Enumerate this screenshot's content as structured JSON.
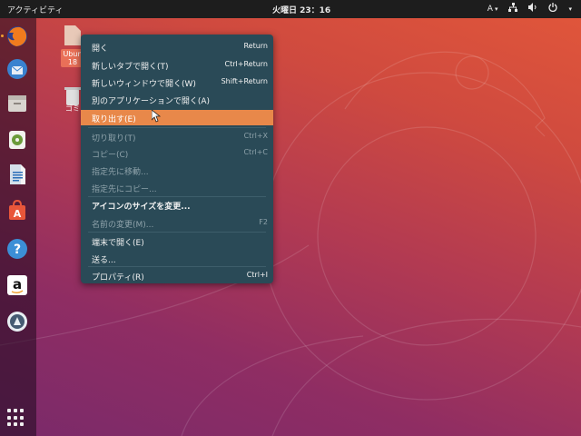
{
  "topbar": {
    "activities": "アクティビティ",
    "clock": "火曜日 23：16",
    "input_method": "A",
    "input_method_caret": "▾",
    "network_icon": "network-icon",
    "volume_icon": "volume-icon",
    "power_icon": "power-icon",
    "menu_caret": "▾"
  },
  "dock": {
    "items": [
      {
        "name": "Firefox",
        "icon": "firefox-icon",
        "color": "#e76b1a"
      },
      {
        "name": "Thunderbird",
        "icon": "thunderbird-icon",
        "color": "#2f6fb8"
      },
      {
        "name": "Files",
        "icon": "files-icon",
        "color": "#c9c6c1"
      },
      {
        "name": "Rhythmbox",
        "icon": "rhythmbox-icon",
        "color": "#e9e9e6"
      },
      {
        "name": "LibreOffice Writer",
        "icon": "writer-icon",
        "color": "#2a6fb8"
      },
      {
        "name": "Ubuntu Software",
        "icon": "software-icon",
        "color": "#e9563a"
      },
      {
        "name": "Help",
        "icon": "help-icon",
        "color": "#3c8fd6"
      },
      {
        "name": "Amazon",
        "icon": "amazon-icon",
        "color": "#ffffff"
      },
      {
        "name": "Disk Utility",
        "icon": "disk-icon",
        "color": "#455b73"
      }
    ],
    "show_apps_icon": "grid-icon"
  },
  "desktop": {
    "icon1_label_top": "Ubun",
    "icon1_label_bottom": "18",
    "icon2_label": "ゴミ"
  },
  "menu": {
    "items": [
      {
        "label": "開く",
        "shortcut": "Return",
        "state": "normal"
      },
      {
        "label": "新しいタブで開く(T)",
        "shortcut": "Ctrl+Return",
        "state": "normal"
      },
      {
        "label": "新しいウィンドウで開く(W)",
        "shortcut": "Shift+Return",
        "state": "normal"
      },
      {
        "label": "別のアプリケーションで開く(A)",
        "shortcut": "",
        "state": "normal"
      },
      {
        "label": "取り出す(E)",
        "shortcut": "",
        "state": "hover"
      },
      {
        "label": "切り取り(T)",
        "shortcut": "Ctrl+X",
        "state": "disabled"
      },
      {
        "label": "コピー(C)",
        "shortcut": "Ctrl+C",
        "state": "disabled"
      },
      {
        "label": "指定先に移動...",
        "shortcut": "",
        "state": "disabled"
      },
      {
        "label": "指定先にコピー...",
        "shortcut": "",
        "state": "disabled"
      },
      {
        "label": "アイコンのサイズを変更...",
        "shortcut": "",
        "state": "normal"
      },
      {
        "label": "名前の変更(M)...",
        "shortcut": "F2",
        "state": "disabled"
      },
      {
        "label": "端末で開く(E)",
        "shortcut": "",
        "state": "normal"
      },
      {
        "label": "送る...",
        "shortcut": "",
        "state": "normal"
      },
      {
        "label": "プロパティ(R)",
        "shortcut": "Ctrl+I",
        "state": "normal"
      }
    ]
  },
  "colors": {
    "menu_bg": "#2a4a57",
    "menu_highlight": "#e8884a",
    "topbar_bg": "#1d1d1d"
  }
}
